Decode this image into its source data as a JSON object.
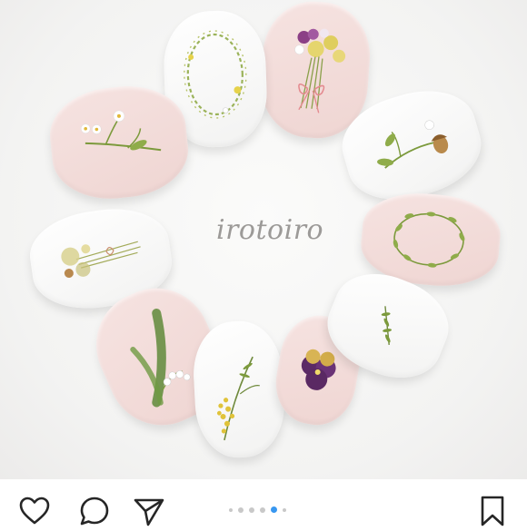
{
  "post": {
    "watermark": "irotoiro",
    "carousel": {
      "count": 6,
      "active_index": 4
    }
  },
  "actions": {
    "like_icon": "heart-outline-icon",
    "comment_icon": "comment-bubble-icon",
    "share_icon": "paper-plane-icon",
    "save_icon": "bookmark-outline-icon"
  },
  "colors": {
    "nail_pink": "#efd5d2",
    "nail_white": "#f7f7f6",
    "active_dot": "#3897f0",
    "inactive_dot": "#c8c8c8",
    "icon": "#262626"
  }
}
